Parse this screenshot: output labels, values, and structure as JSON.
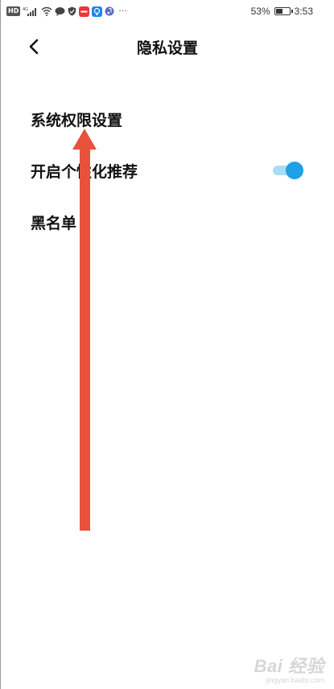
{
  "status_bar": {
    "hd_label": "HD",
    "signal_label": "4G",
    "more_label": "···",
    "battery_percent": "53%",
    "battery_level": 0.53,
    "time": "3:53",
    "app_icon_colors": [
      "#e53935",
      "#1e88e5",
      "#5c6bc0"
    ]
  },
  "header": {
    "back_icon": "chevron-left-icon",
    "title": "隐私设置"
  },
  "settings": {
    "items": [
      {
        "label": "系统权限设置"
      },
      {
        "label": "开启个性化推荐",
        "toggle_on": true
      },
      {
        "label": "黑名单"
      }
    ]
  },
  "colors": {
    "toggle_on": "#1e9fe6",
    "toggle_track": "#a9dcf4",
    "annotation_arrow": "#e8513a"
  },
  "watermark": {
    "text": "Bai 经验",
    "subtext": "jingyan.baidu.com"
  }
}
